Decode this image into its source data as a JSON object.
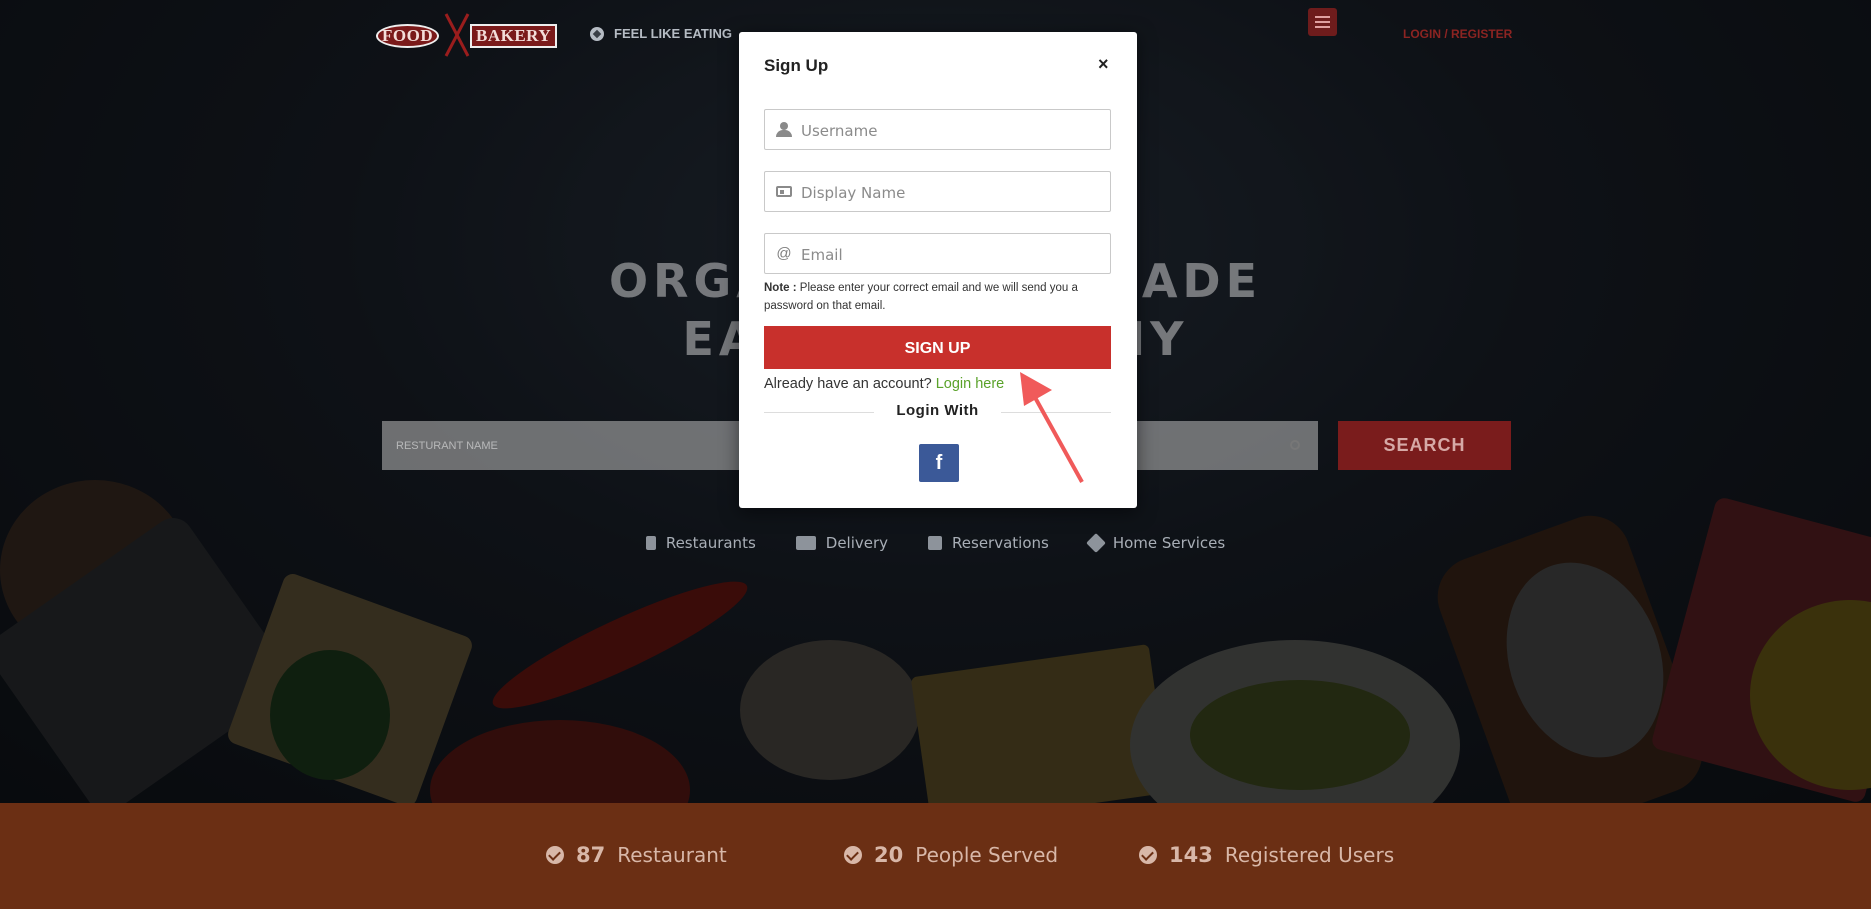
{
  "header": {
    "logo_left": "FOOD",
    "logo_right": "BAKERY",
    "feel_like_eating": "FEEL LIKE EATING",
    "login_register": "LOGIN / REGISTER"
  },
  "hero": {
    "headline_line1": "ORGANIC FOOD MADE",
    "headline_line2": "EASY & HEALTHY",
    "search_placeholder": "RESTURANT NAME",
    "search_button": "SEARCH"
  },
  "services": [
    {
      "label": "Restaurants",
      "icon": "fork-knife-icon"
    },
    {
      "label": "Delivery",
      "icon": "truck-icon"
    },
    {
      "label": "Reservations",
      "icon": "calendar-icon"
    },
    {
      "label": "Home Services",
      "icon": "tools-icon"
    }
  ],
  "stats": [
    {
      "value": "87",
      "label": "Restaurant"
    },
    {
      "value": "20",
      "label": "People Served"
    },
    {
      "value": "143",
      "label": "Registered Users"
    }
  ],
  "modal": {
    "title": "Sign Up",
    "close": "×",
    "username_placeholder": "Username",
    "display_name_placeholder": "Display Name",
    "email_placeholder": "Email",
    "note_label": "Note :",
    "note_text": "Please enter your correct email and we will send you a password on that email.",
    "signup_button": "SIGN UP",
    "already_text": "Already have an account?",
    "login_here": "Login here",
    "login_with": "Login With",
    "facebook": "f"
  },
  "colors": {
    "brand_red": "#c8302c",
    "stats_bar": "#6b2f14",
    "link_green": "#5aa22a",
    "facebook_blue": "#3b5998"
  }
}
